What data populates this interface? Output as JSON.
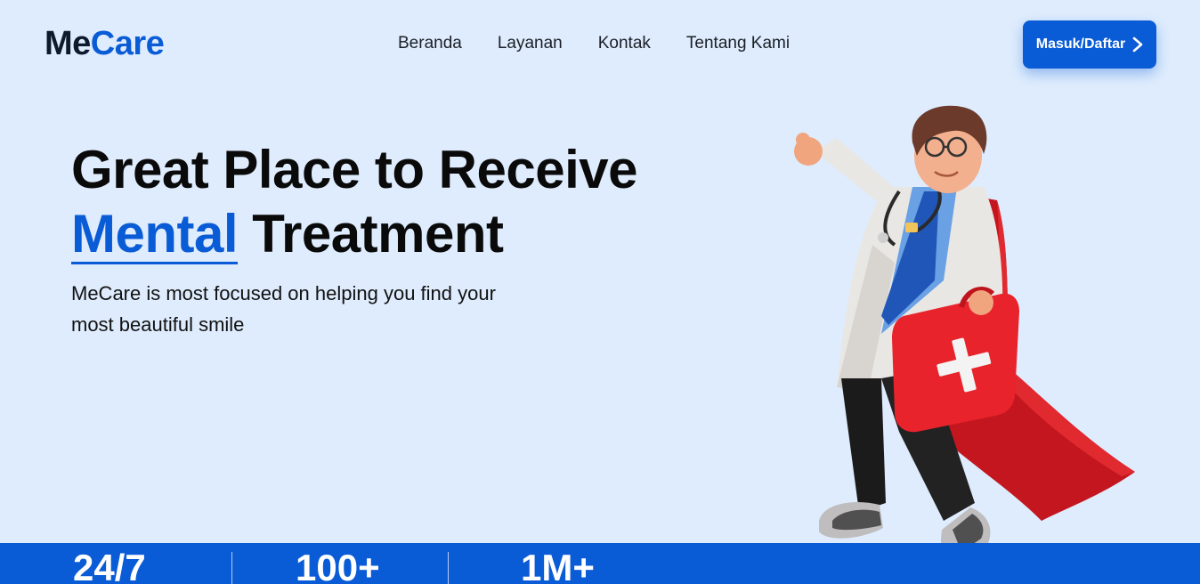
{
  "brand": {
    "name_part1": "Me",
    "name_part2": "Care",
    "primary_color": "#0a5bd6",
    "dark_color": "#0c1a2c",
    "background_color": "#deecfd"
  },
  "nav": {
    "items": [
      {
        "label": "Beranda"
      },
      {
        "label": "Layanan"
      },
      {
        "label": "Kontak"
      },
      {
        "label": "Tentang Kami"
      }
    ]
  },
  "header": {
    "login_label": "Masuk/Daftar",
    "login_icon": "chevron-right-icon"
  },
  "hero": {
    "title_line1": "Great Place to Receive",
    "title_accent": "Mental",
    "title_rest": " Treatment",
    "subtitle": "MeCare is most focused on helping you find your most beautiful smile",
    "illustration": "doctor-superhero-illustration"
  },
  "stats": [
    {
      "value": "24/7"
    },
    {
      "value": "100+"
    },
    {
      "value": "1M+"
    }
  ]
}
